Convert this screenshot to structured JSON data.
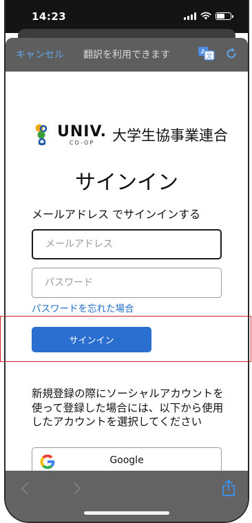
{
  "status_bar": {
    "time": "14:23"
  },
  "toolbar": {
    "cancel_label": "キャンセル",
    "translate_message": "翻訳を利用できます",
    "translate_icon": "translate-icon",
    "reload_icon": "reload-icon"
  },
  "logo": {
    "univ_text": "UNIV.",
    "coop_text": "CO-OP",
    "org_name": "大学生協事業連合"
  },
  "page": {
    "title": "サインイン",
    "subtitle": "メールアドレス でサインインする"
  },
  "form": {
    "email_placeholder": "メールアドレス",
    "email_value": "",
    "password_placeholder": "パスワード",
    "password_value": "",
    "forgot_password_label": "パスワードを忘れた場合",
    "signin_button_label": "サインイン"
  },
  "social": {
    "description": "新規登録の際にソーシャルアカウントを使って登録した場合には、以下から使用したアカウントを選択してください",
    "google_label": "Google"
  },
  "colors": {
    "accent_blue": "#2a6fd0",
    "link_blue": "#1e6ec8",
    "highlight_red": "#d0242a"
  }
}
